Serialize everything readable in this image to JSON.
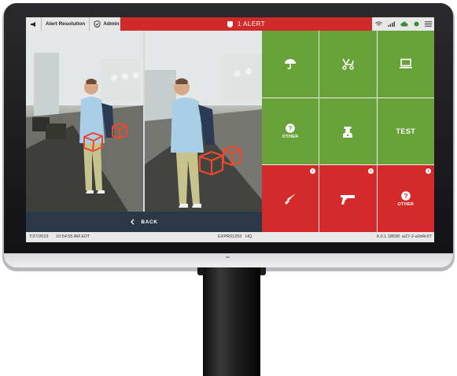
{
  "topbar": {
    "megaphone_icon": "megaphone-icon",
    "alert_resolution_label": "Alert Resolution",
    "admin_label": "Admin",
    "alert_text": "1 ALERT",
    "status_icons": [
      "wifi-icon",
      "signal-icon",
      "cloud-icon",
      "status-dot-icon",
      "menu-icon"
    ]
  },
  "camera": {
    "back_label": "BACK"
  },
  "tiles": [
    {
      "label": "",
      "icon": "umbrella-icon",
      "color": "#6aa23a"
    },
    {
      "label": "",
      "icon": "stroller-icon",
      "color": "#6aa23a"
    },
    {
      "label": "",
      "icon": "laptop-icon",
      "color": "#6aa23a"
    },
    {
      "label": "OTHER",
      "icon": "question-icon",
      "color": "#6aa23a"
    },
    {
      "label": "",
      "icon": "officer-icon",
      "color": "#6aa23a"
    },
    {
      "label": "TEST",
      "icon": "",
      "color": "#6aa23a"
    },
    {
      "label": "",
      "icon": "knife-icon",
      "color": "#d42a2b"
    },
    {
      "label": "",
      "icon": "gun-icon",
      "color": "#d42a2b"
    },
    {
      "label": "OTHER",
      "icon": "question-icon",
      "color": "#d42a2b"
    }
  ],
  "footer": {
    "date": "7/27/2023",
    "time": "10:54:55 AM EDT",
    "device": "EXPR01259",
    "location": "HQ",
    "version": "6.0.1.18938",
    "build": "w27-2-a0d4c07"
  }
}
